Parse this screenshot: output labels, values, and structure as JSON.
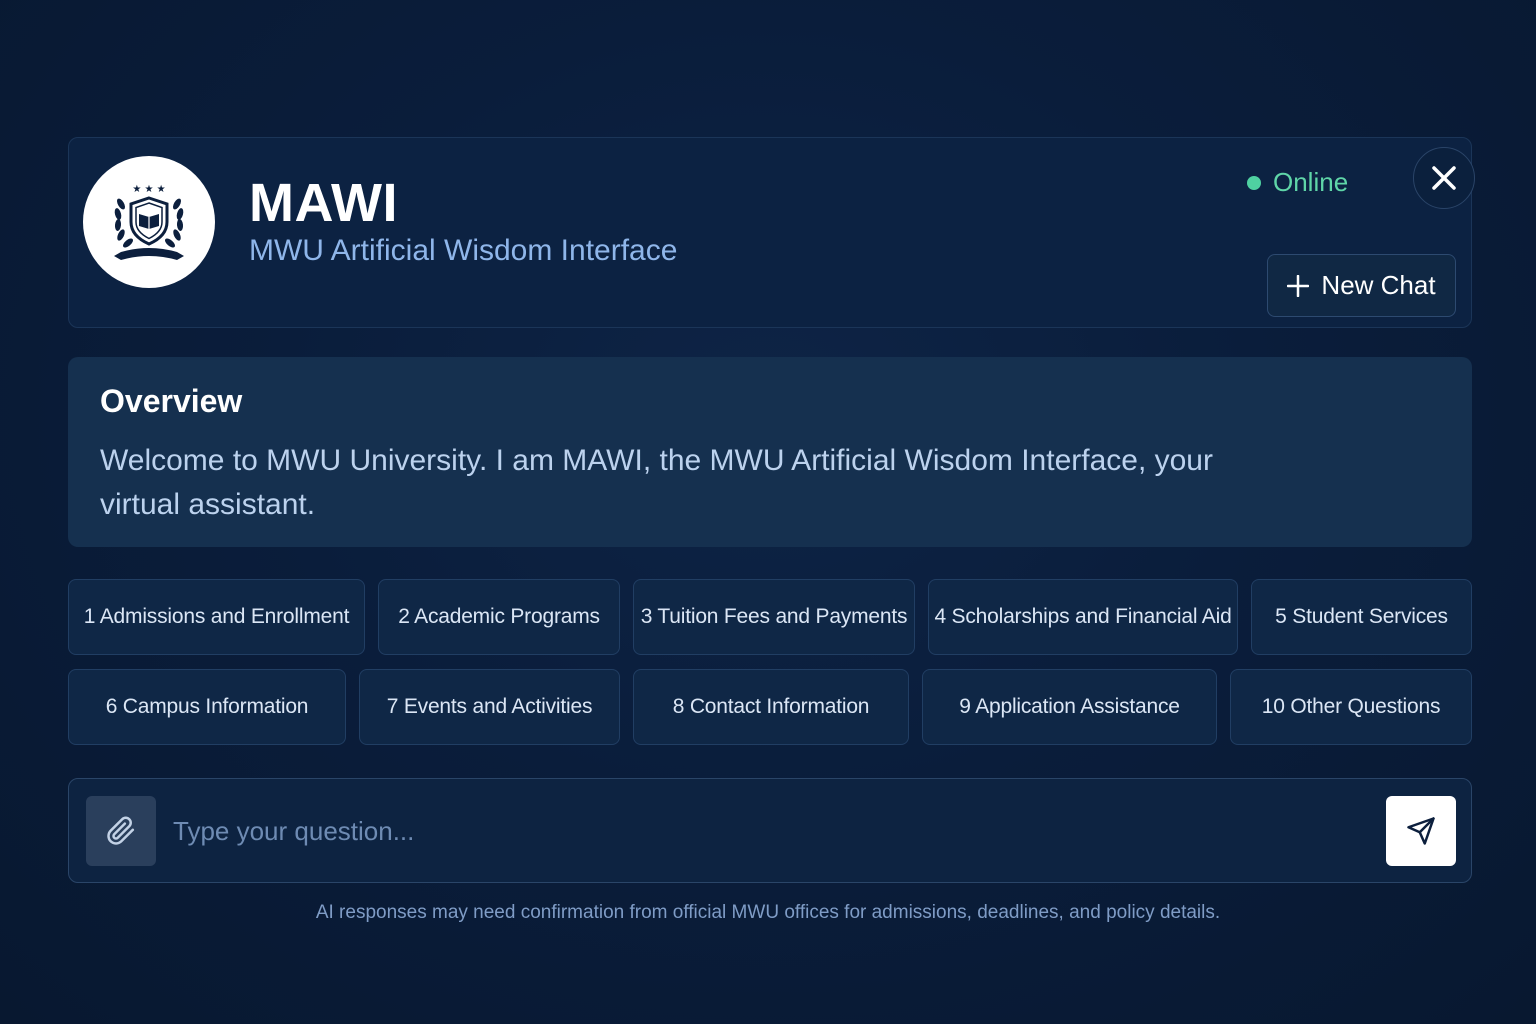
{
  "header": {
    "title": "MAWI",
    "subtitle": "MWU Artificial Wisdom Interface",
    "status": "Online",
    "new_chat_label": "New Chat",
    "logo_icon": "university-crest-icon",
    "close_icon": "close-icon"
  },
  "overview": {
    "title": "Overview",
    "text": "Welcome to MWU University. I am MAWI, the MWU Artificial Wisdom Interface, your virtual assistant."
  },
  "topics": [
    {
      "label": "1 Admissions and Enrollment"
    },
    {
      "label": "2 Academic Programs"
    },
    {
      "label": "3 Tuition Fees and Payments"
    },
    {
      "label": "4 Scholarships and Financial Aid"
    },
    {
      "label": "5 Student Services"
    },
    {
      "label": "6 Campus Information"
    },
    {
      "label": "7 Events and Activities"
    },
    {
      "label": "8 Contact Information"
    },
    {
      "label": "9 Application Assistance"
    },
    {
      "label": "10 Other Questions"
    }
  ],
  "input": {
    "placeholder": "Type your question...",
    "value": "",
    "attach_icon": "paperclip-icon",
    "send_icon": "send-icon"
  },
  "disclaimer": "AI responses may need confirmation from official MWU offices for admissions, deadlines, and policy details.",
  "colors": {
    "background": "#0a1d3b",
    "accent_text": "#8fb6ea",
    "status_green": "#4fd1a1",
    "card": "#15304f"
  }
}
